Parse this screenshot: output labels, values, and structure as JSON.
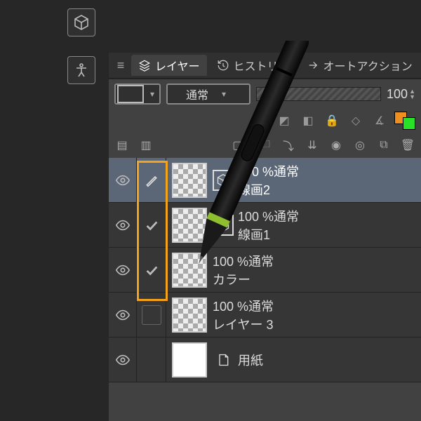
{
  "left_icons": [
    "cube",
    "accessibility"
  ],
  "tabs": {
    "layer": "レイヤー",
    "history": "ヒストリー",
    "auto": "オートアクション"
  },
  "blend_mode": "通常",
  "opacity_value": "100",
  "layers": [
    {
      "pct": "100 %通常",
      "name": "線画2",
      "extra": "cube",
      "selected": true,
      "lock": "pen"
    },
    {
      "pct": "100 %通常",
      "name": "線画1",
      "extra": "cube",
      "selected": false,
      "lock": "check"
    },
    {
      "pct": "100 %通常",
      "name": "カラー",
      "extra": null,
      "selected": false,
      "lock": "check"
    },
    {
      "pct": "100 %通常",
      "name": "レイヤー 3",
      "extra": null,
      "selected": false,
      "lock": "none"
    },
    {
      "pct": "",
      "name": "用紙",
      "extra": "paper",
      "selected": false,
      "lock": "blank",
      "thumb": "white"
    }
  ],
  "colors": {
    "fg": "#ee8f1f",
    "bg": "#29e029"
  }
}
